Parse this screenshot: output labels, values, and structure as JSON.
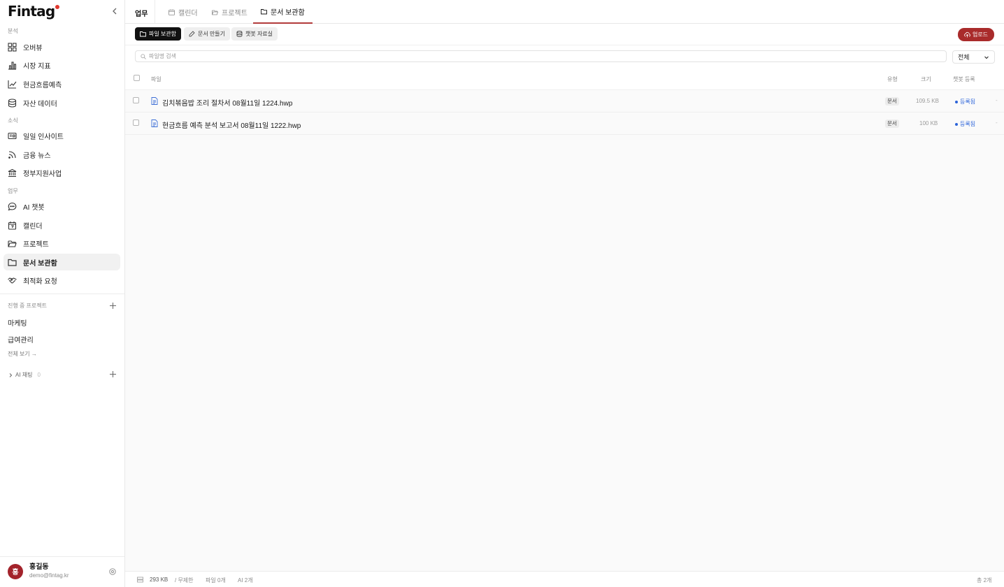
{
  "brand": {
    "name": "Fintag",
    "accent": "#e0372d"
  },
  "sidebar": {
    "sections": [
      {
        "label": "분석"
      },
      {
        "label": "소식"
      },
      {
        "label": "업무"
      }
    ],
    "items": [
      {
        "label": "오버뷰",
        "icon": "grid-icon"
      },
      {
        "label": "시장 지표",
        "icon": "bar-chart-icon"
      },
      {
        "label": "현금흐름예측",
        "icon": "trend-icon"
      },
      {
        "label": "자산 데이터",
        "icon": "database-icon"
      },
      {
        "label": "일일 인사이트",
        "icon": "newspaper-icon"
      },
      {
        "label": "금융 뉴스",
        "icon": "rss-icon"
      },
      {
        "label": "정부지원사업",
        "icon": "bank-icon"
      },
      {
        "label": "AI 챗봇",
        "icon": "chat-icon"
      },
      {
        "label": "캘린더",
        "icon": "calendar-icon"
      },
      {
        "label": "프로젝트",
        "icon": "folder-open-icon"
      },
      {
        "label": "문서 보관함",
        "icon": "folder-icon",
        "active": true
      },
      {
        "label": "최적화 요청",
        "icon": "handshake-icon"
      }
    ],
    "projects_header": "진행 중 프로젝트",
    "projects": [
      "마케팅",
      "급여관리"
    ],
    "view_all": "전체 보기 →",
    "ai_chat": {
      "label": "AI 채팅",
      "count": "0"
    },
    "user": {
      "initial": "홍",
      "name": "홍길동",
      "email": "demo@fintag.kr"
    }
  },
  "topbar": {
    "workspace": "업무",
    "tabs": [
      {
        "label": "캘린더",
        "icon": "calendar-icon"
      },
      {
        "label": "프로젝트",
        "icon": "folder-open-icon"
      },
      {
        "label": "문서 보관함",
        "icon": "folder-icon",
        "active": true
      }
    ]
  },
  "toolbar": {
    "buttons": [
      {
        "label": "파일 보관함",
        "icon": "folder-icon",
        "active": true
      },
      {
        "label": "문서 만들기",
        "icon": "pencil-icon"
      },
      {
        "label": "챗봇 자료실",
        "icon": "database-icon"
      }
    ],
    "upload_label": "업로드",
    "upload_color": "#a92b2b"
  },
  "search": {
    "placeholder": "파일명 검색",
    "value": ""
  },
  "filter": {
    "selected": "전체"
  },
  "table": {
    "columns": {
      "file": "파일",
      "type": "유형",
      "size": "크기",
      "chatbot": "챗봇 등록"
    },
    "rows": [
      {
        "name": "김치볶음밥 조리 절차서 08월11일 1224.hwp",
        "type": "문서",
        "size": "109.5 KB",
        "status": "등록됨",
        "more": "-"
      },
      {
        "name": "현금흐름 예측 분석 보고서 08월11일 1222.hwp",
        "type": "문서",
        "size": "100 KB",
        "status": "등록됨",
        "more": "-"
      }
    ]
  },
  "footer": {
    "storage": "293 KB",
    "limit": "/ 무제한",
    "files": "파일 0개",
    "ai": "AI 2개",
    "total": "총 2개"
  }
}
